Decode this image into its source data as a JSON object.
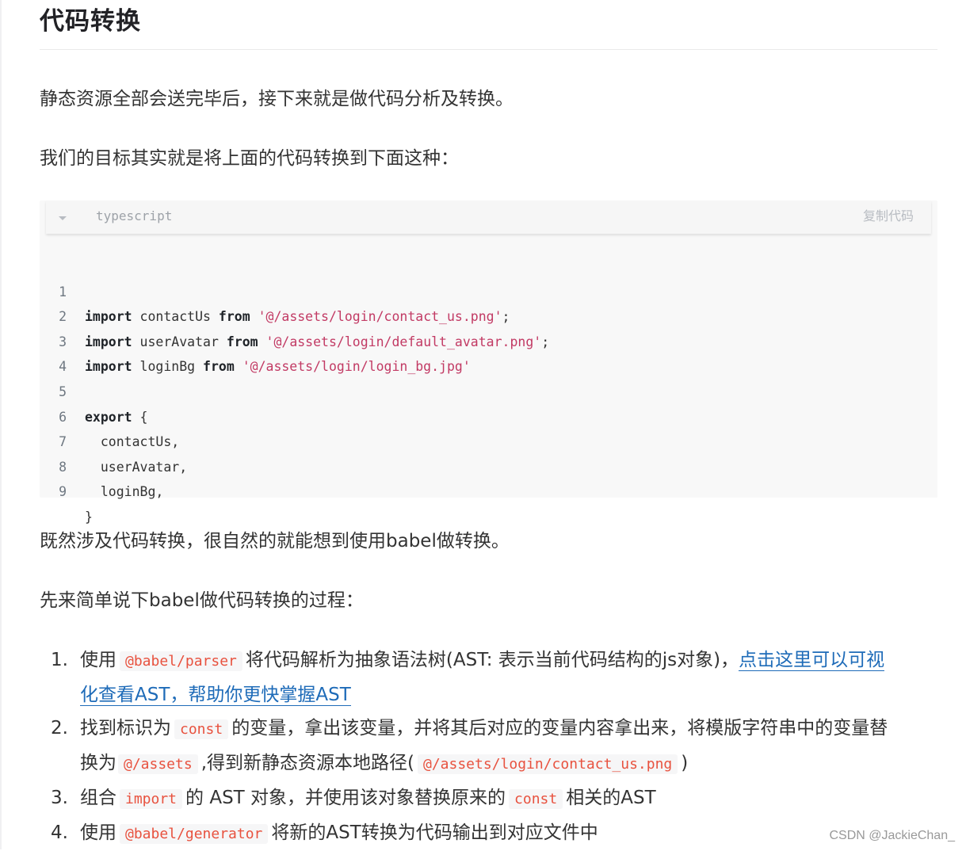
{
  "article": {
    "title": "代码转换",
    "para1": "静态资源全部会送完毕后，接下来就是做代码分析及转换。",
    "para2": "我们的目标其实就是将上面的代码转换到下面这种：",
    "para3": "既然涉及代码转换，很自然的就能想到使用babel做转换。",
    "para4": "先来简单说下babel做代码转换的过程："
  },
  "code_block": {
    "language": "typescript",
    "copy_label": "复制代码",
    "collapse_icon": "caret-down-icon",
    "lines": [
      {
        "num": "1",
        "kw1": "import",
        "t1": " contactUs ",
        "kw2": "from",
        "t2": " ",
        "str": "'@/assets/login/contact_us.png'",
        "t3": ";"
      },
      {
        "num": "2",
        "kw1": "import",
        "t1": " userAvatar ",
        "kw2": "from",
        "t2": " ",
        "str": "'@/assets/login/default_avatar.png'",
        "t3": ";"
      },
      {
        "num": "3",
        "kw1": "import",
        "t1": " loginBg ",
        "kw2": "from",
        "t2": " ",
        "str": "'@/assets/login/login_bg.jpg'",
        "t3": ""
      },
      {
        "num": "4",
        "kw1": "",
        "t1": "",
        "kw2": "",
        "t2": "",
        "str": "",
        "t3": ""
      },
      {
        "num": "5",
        "kw1": "export",
        "t1": " {",
        "kw2": "",
        "t2": "",
        "str": "",
        "t3": ""
      },
      {
        "num": "6",
        "kw1": "",
        "t1": "  contactUs,",
        "kw2": "",
        "t2": "",
        "str": "",
        "t3": ""
      },
      {
        "num": "7",
        "kw1": "",
        "t1": "  userAvatar,",
        "kw2": "",
        "t2": "",
        "str": "",
        "t3": ""
      },
      {
        "num": "8",
        "kw1": "",
        "t1": "  loginBg,",
        "kw2": "",
        "t2": "",
        "str": "",
        "t3": ""
      },
      {
        "num": "9",
        "kw1": "",
        "t1": "}",
        "kw2": "",
        "t2": "",
        "str": "",
        "t3": ""
      }
    ]
  },
  "steps": [
    {
      "num": "1.",
      "pre": "使用",
      "code1": "@babel/parser",
      "mid": "将代码解析为抽象语法树(AST: 表示当前代码结构的js对象)，",
      "link_line1": "点击这里可以可视",
      "link_line2": "化查看AST，帮助你更快掌握AST"
    },
    {
      "num": "2.",
      "pre": "找到标识为",
      "code1": "const",
      "mid": "的变量，拿出该变量，并将其后对应的变量内容拿出来，将模版字符串中的变量替",
      "line2_pre": "换为",
      "code2": "@/assets",
      "line2_mid": ",得到新静态资源本地路径(",
      "code3": "@/assets/login/contact_us.png",
      "line2_post": ")"
    },
    {
      "num": "3.",
      "pre": "组合",
      "code1": "import",
      "mid": "的 AST 对象，并使用该对象替换原来的",
      "code2": "const",
      "post": "相关的AST"
    },
    {
      "num": "4.",
      "pre": "使用",
      "code1": "@babel/generator",
      "mid": "将新的AST转换为代码输出到对应文件中"
    }
  ],
  "watermark": "CSDN @JackieChan_"
}
